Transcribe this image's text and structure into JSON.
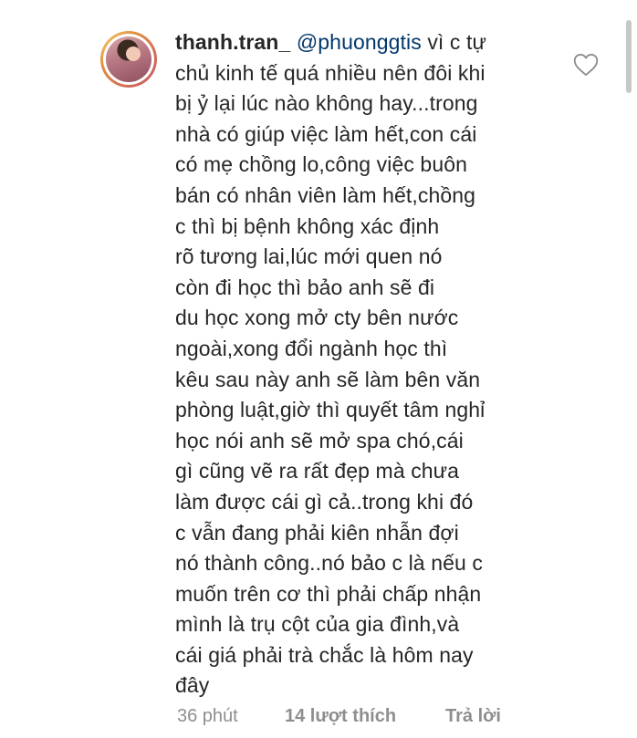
{
  "comment": {
    "username": "thanh.tran_",
    "mention": "@phuonggtis",
    "text": " vì c tự\nchủ kinh tế quá nhiều nên đôi khi\nbị ỷ lại lúc nào không hay...trong\nnhà có giúp việc làm hết,con cái\ncó mẹ chồng lo,công việc buôn\nbán có nhân viên làm hết,chồng\nc thì bị bệnh không xác định\nrõ tương lai,lúc mới quen nó\ncòn đi học thì bảo anh sẽ đi\ndu học xong mở cty bên nước\nngoài,xong đổi ngành học thì\nkêu sau này anh sẽ làm bên văn\nphòng luật,giờ thì quyết tâm nghỉ\nhọc nói anh sẽ mở spa chó,cái\ngì cũng vẽ ra rất đẹp mà chưa\nlàm được cái gì cả..trong khi đó\nc vẫn đang phải kiên nhẫn đợi\nnó thành công..nó bảo c là nếu c\nmuốn trên cơ thì phải chấp nhận\nmình là trụ cột của gia đình,và\ncái giá phải trà chắc là hôm nay\nđây",
    "time": "36 phút",
    "likes": "14 lượt thích",
    "reply": "Trả lời"
  },
  "icons": {
    "like": "heart-outline-icon"
  },
  "colors": {
    "text": "#262626",
    "mention": "#00376b",
    "meta": "#8e8e8e"
  }
}
